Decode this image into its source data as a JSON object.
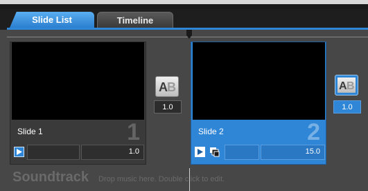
{
  "tabs": [
    {
      "label": "Slide List",
      "active": true
    },
    {
      "label": "Timeline",
      "active": false
    }
  ],
  "slides": [
    {
      "label": "Slide 1",
      "number": "1",
      "duration": "1.0",
      "selected": false
    },
    {
      "label": "Slide 2",
      "number": "2",
      "duration": "15.0",
      "selected": true
    }
  ],
  "transitions": [
    {
      "icon": "ab-transition-icon",
      "duration": "1.0",
      "selected": false
    },
    {
      "icon": "ab-transition-icon",
      "duration": "1.0",
      "selected": true
    }
  ],
  "soundtrack": {
    "label": "Soundtrack",
    "hint": "Drop music here.  Double click to edit."
  },
  "colors": {
    "accent": "#2f86d6",
    "background": "#474747",
    "tab_bar": "#1e1e1e"
  }
}
